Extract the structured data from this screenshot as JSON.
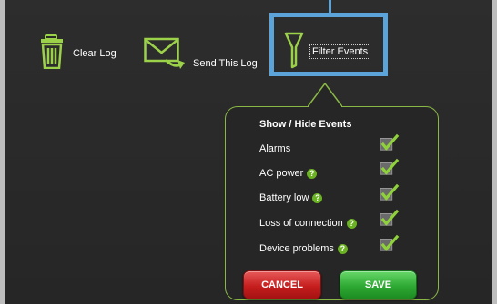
{
  "toolbar": {
    "clear_label": "Clear Log",
    "send_label": "Send This Log",
    "filter_label": "Filter Events"
  },
  "icons": {
    "clear": "trash-icon",
    "send": "envelope-icon",
    "filter": "funnel-icon",
    "help": "help-icon",
    "check": "checkmark-icon"
  },
  "panel": {
    "title": "Show / Hide Events",
    "items": [
      {
        "label": "Alarms",
        "help": false,
        "checked": true
      },
      {
        "label": "AC power",
        "help": true,
        "checked": true
      },
      {
        "label": "Battery low",
        "help": true,
        "checked": true
      },
      {
        "label": "Loss of connection",
        "help": true,
        "checked": true
      },
      {
        "label": "Device problems",
        "help": true,
        "checked": true
      }
    ],
    "help_glyph": "?",
    "cancel_label": "CANCEL",
    "save_label": "SAVE"
  },
  "colors": {
    "accent_green": "#8ab844",
    "highlight_blue": "#5ba3d9",
    "cancel_red": "#c61e1e",
    "save_green": "#2ea933"
  }
}
